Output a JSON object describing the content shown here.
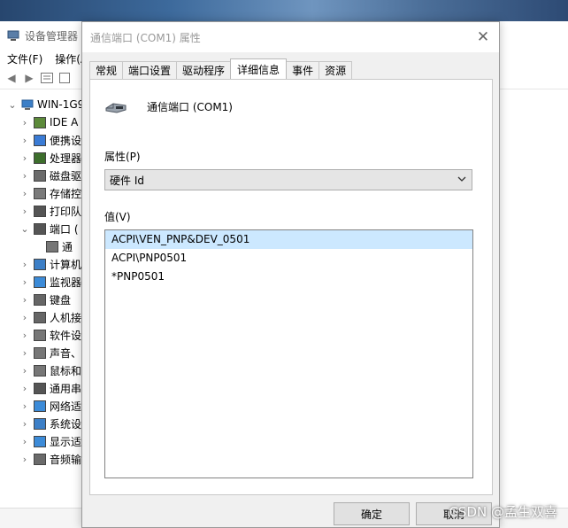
{
  "background_window": {
    "title": "设备管理器",
    "menu": [
      "文件(F)",
      "操作(A)"
    ],
    "tree_root": "WIN-1G9",
    "tree_items": [
      {
        "label": "IDE A",
        "icon": "ide-controller-icon"
      },
      {
        "label": "便携设",
        "icon": "portable-device-icon"
      },
      {
        "label": "处理器",
        "icon": "processor-icon"
      },
      {
        "label": "磁盘驱",
        "icon": "disk-drive-icon"
      },
      {
        "label": "存储控",
        "icon": "storage-controller-icon"
      },
      {
        "label": "打印队",
        "icon": "print-queue-icon"
      },
      {
        "label": "端口 (",
        "icon": "port-icon",
        "expanded": true
      },
      {
        "label": "通",
        "icon": "serial-port-icon",
        "child": true
      },
      {
        "label": "计算机",
        "icon": "computer-icon"
      },
      {
        "label": "监视器",
        "icon": "monitor-icon"
      },
      {
        "label": "键盘",
        "icon": "keyboard-icon"
      },
      {
        "label": "人机接",
        "icon": "hid-icon"
      },
      {
        "label": "软件设",
        "icon": "software-device-icon"
      },
      {
        "label": "声音、",
        "icon": "sound-icon"
      },
      {
        "label": "鼠标和",
        "icon": "mouse-icon"
      },
      {
        "label": "通用串",
        "icon": "usb-icon"
      },
      {
        "label": "网络适",
        "icon": "network-adapter-icon"
      },
      {
        "label": "系统设",
        "icon": "system-device-icon"
      },
      {
        "label": "显示适",
        "icon": "display-adapter-icon"
      },
      {
        "label": "音频输",
        "icon": "audio-io-icon"
      }
    ]
  },
  "dialog": {
    "title": "通信端口 (COM1) 属性",
    "tabs": [
      "常规",
      "端口设置",
      "驱动程序",
      "详细信息",
      "事件",
      "资源"
    ],
    "active_tab": "详细信息",
    "device_name": "通信端口 (COM1)",
    "property_label": "属性(P)",
    "property_value": "硬件 Id",
    "value_label": "值(V)",
    "values": [
      "ACPI\\VEN_PNP&DEV_0501",
      "ACPI\\PNP0501",
      "*PNP0501"
    ],
    "selected_index": 0,
    "ok_label": "确定",
    "cancel_label": "取消"
  },
  "watermark": "CSDN @孟生双喜",
  "colors": {
    "selection": "#cce8ff",
    "dialog_bg": "#f0f0f0",
    "button_bg": "#e1e1e1"
  }
}
